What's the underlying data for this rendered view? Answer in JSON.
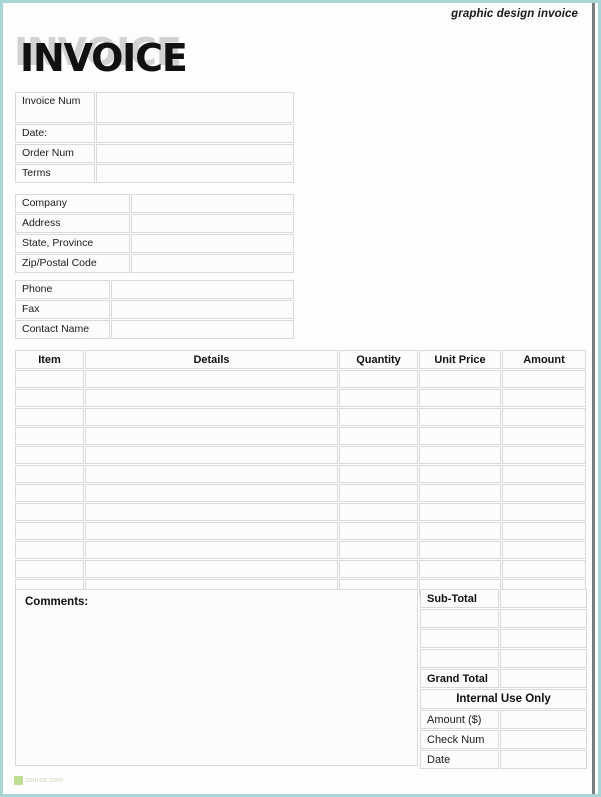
{
  "header": {
    "kicker": "graphic design invoice",
    "title": "INVOICE"
  },
  "invoice_meta": {
    "rows": [
      {
        "label": "Invoice Num",
        "value": ""
      },
      {
        "label": "Date:",
        "value": ""
      },
      {
        "label": "Order Num",
        "value": ""
      },
      {
        "label": "Terms",
        "value": ""
      }
    ]
  },
  "bill_to": {
    "rows": [
      {
        "label": "Company",
        "value": ""
      },
      {
        "label": "Address",
        "value": ""
      },
      {
        "label": "State, Province",
        "value": ""
      },
      {
        "label": "Zip/Postal Code",
        "value": ""
      }
    ]
  },
  "contact": {
    "rows": [
      {
        "label": "Phone",
        "value": ""
      },
      {
        "label": "Fax",
        "value": ""
      },
      {
        "label": "Contact Name",
        "value": ""
      }
    ]
  },
  "items_table": {
    "columns": [
      "Item",
      "Details",
      "Quantity",
      "Unit Price",
      "Amount"
    ],
    "rows": [
      {
        "item": "",
        "details": "",
        "quantity": "",
        "unit_price": "",
        "amount": ""
      },
      {
        "item": "",
        "details": "",
        "quantity": "",
        "unit_price": "",
        "amount": ""
      },
      {
        "item": "",
        "details": "",
        "quantity": "",
        "unit_price": "",
        "amount": ""
      },
      {
        "item": "",
        "details": "",
        "quantity": "",
        "unit_price": "",
        "amount": ""
      },
      {
        "item": "",
        "details": "",
        "quantity": "",
        "unit_price": "",
        "amount": ""
      },
      {
        "item": "",
        "details": "",
        "quantity": "",
        "unit_price": "",
        "amount": ""
      },
      {
        "item": "",
        "details": "",
        "quantity": "",
        "unit_price": "",
        "amount": ""
      },
      {
        "item": "",
        "details": "",
        "quantity": "",
        "unit_price": "",
        "amount": ""
      },
      {
        "item": "",
        "details": "",
        "quantity": "",
        "unit_price": "",
        "amount": ""
      },
      {
        "item": "",
        "details": "",
        "quantity": "",
        "unit_price": "",
        "amount": ""
      },
      {
        "item": "",
        "details": "",
        "quantity": "",
        "unit_price": "",
        "amount": ""
      },
      {
        "item": "",
        "details": "",
        "quantity": "",
        "unit_price": "",
        "amount": ""
      }
    ]
  },
  "comments": {
    "label": "Comments:",
    "value": ""
  },
  "totals": {
    "sub_total_label": "Sub-Total",
    "sub_total_value": "",
    "blank_rows": 3,
    "grand_total_label": "Grand Total",
    "grand_total_value": "",
    "internal_banner": "Internal Use Only",
    "internal_rows": [
      {
        "label": "Amount ($)",
        "value": ""
      },
      {
        "label": "Check Num",
        "value": ""
      },
      {
        "label": "Date",
        "value": ""
      }
    ]
  },
  "watermark": {
    "text": "source.com"
  },
  "colors": {
    "page_border": "#a8d5d5",
    "cell_border": "#d9d9d9",
    "cell_fill": "#fcfcfc",
    "title_shadow": "#d2d2d2",
    "text": "#111111",
    "watermark_green": "#8cc63f"
  }
}
